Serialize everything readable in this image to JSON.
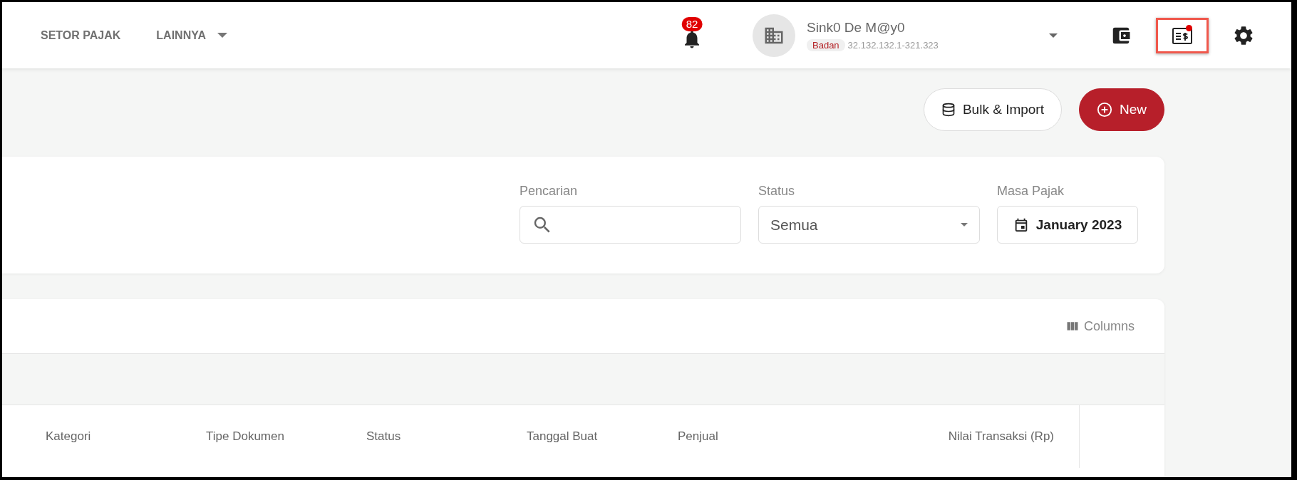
{
  "nav": [
    {
      "label": "SETOR PAJAK",
      "dropdown": false
    },
    {
      "label": "LAINNYA",
      "dropdown": true
    }
  ],
  "notifications": {
    "count": "82"
  },
  "account": {
    "name": "Sink0 De M@y0",
    "type": "Badan",
    "npwp": "32.132.132.1-321.323"
  },
  "toolbar_icons": [
    {
      "kind": "wallet",
      "dot": false,
      "highlighted": false
    },
    {
      "kind": "receipt",
      "dot": true,
      "highlighted": true
    },
    {
      "kind": "settings",
      "dot": false,
      "highlighted": false
    }
  ],
  "actions": [
    {
      "label": "Bulk & Import",
      "kind": "secondary"
    },
    {
      "label": "New",
      "kind": "primary"
    }
  ],
  "filters": [
    {
      "kind": "search",
      "label": "Pencarian"
    },
    {
      "kind": "select",
      "label": "Status",
      "value": "Semua"
    },
    {
      "kind": "date",
      "label": "Masa Pajak",
      "value": "January 2023"
    }
  ],
  "table": {
    "columns_button": "Columns",
    "columns": [
      "Kategori",
      "Tipe Dokumen",
      "Status",
      "Tanggal Buat",
      "Penjual",
      "Nilai Transaksi (Rp)"
    ]
  }
}
